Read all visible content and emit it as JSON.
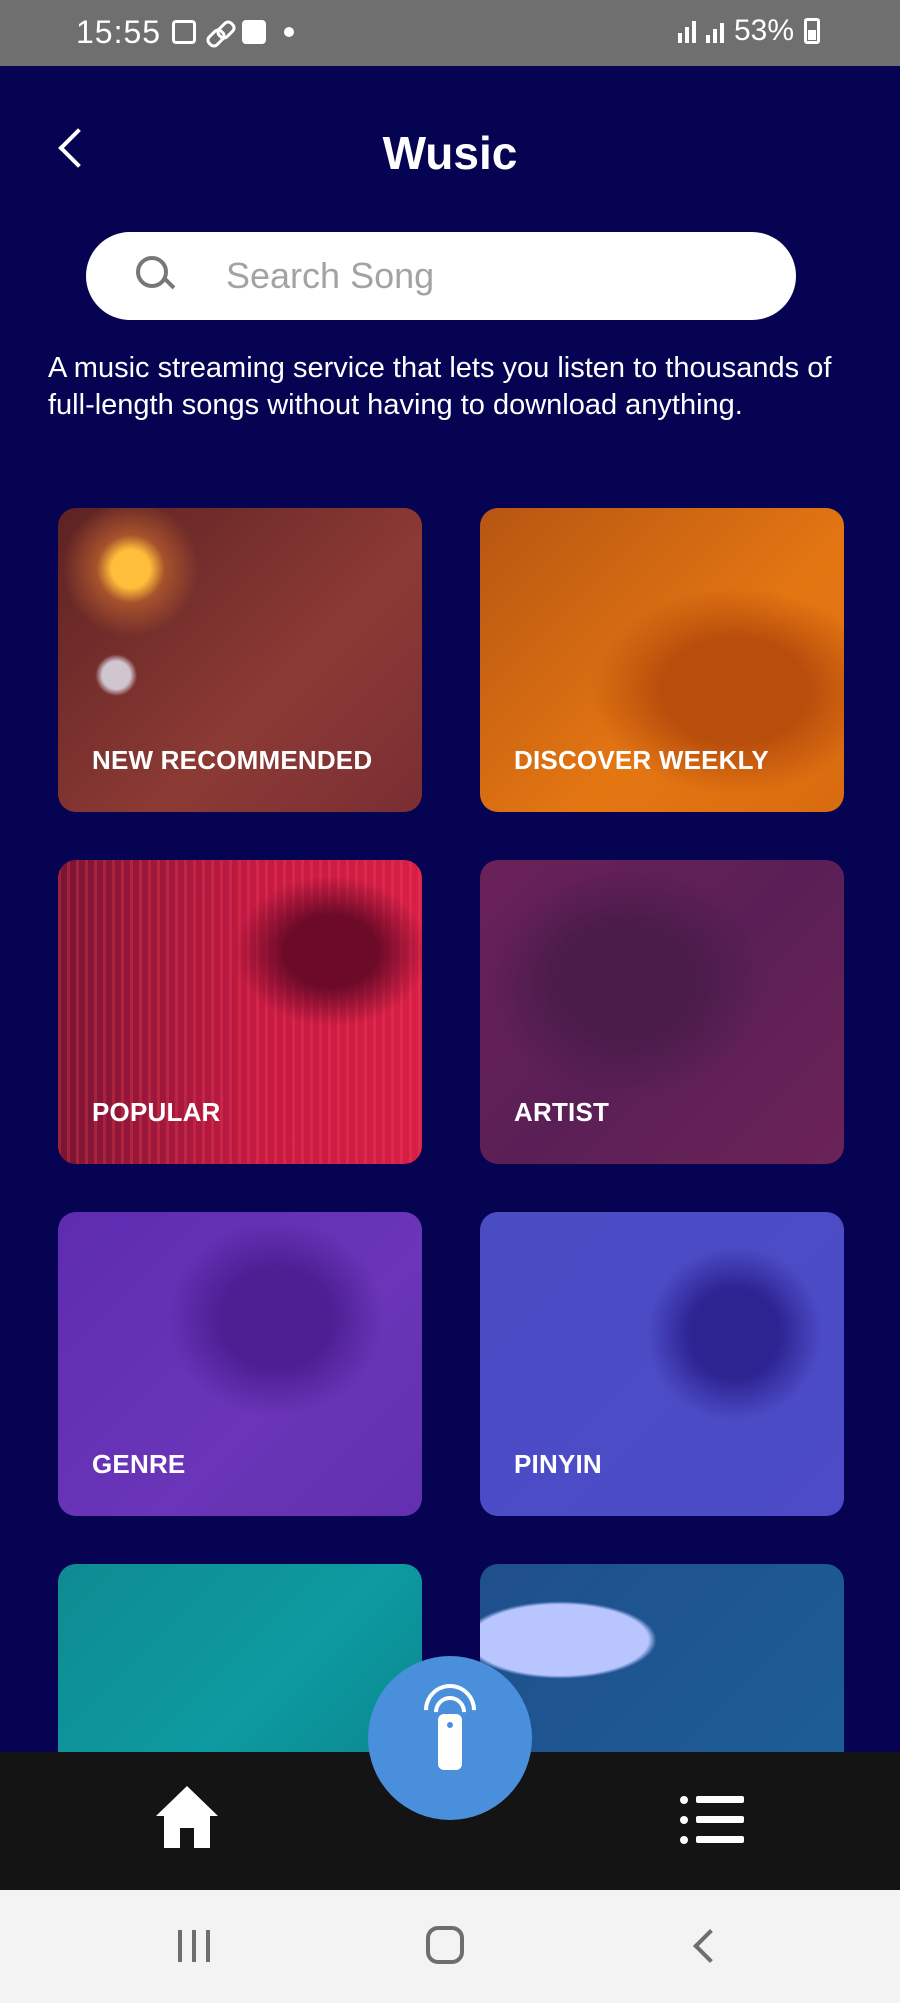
{
  "status_bar": {
    "time": "15:55",
    "battery": "53%"
  },
  "header": {
    "title": "Wusic"
  },
  "search": {
    "placeholder": "Search Song",
    "value": ""
  },
  "description": "A music streaming service that lets you listen to thousands of full-length songs without having to download anything.",
  "categories": [
    {
      "label": "NEW RECOMMENDED",
      "color": "#8c3a34"
    },
    {
      "label": "DISCOVER WEEKLY",
      "color": "#e47612"
    },
    {
      "label": "POPULAR",
      "color": "#c51a44"
    },
    {
      "label": "ARTIST",
      "color": "#5a1f56"
    },
    {
      "label": "GENRE",
      "color": "#6a35b8"
    },
    {
      "label": "PINYIN",
      "color": "#4d4bc7"
    },
    {
      "label": "",
      "color": "#0d9aa0"
    },
    {
      "label": "",
      "color": "#1d5d96"
    }
  ],
  "bottom_nav": {
    "items": [
      {
        "icon": "home-icon"
      },
      {
        "icon": "remote-icon"
      },
      {
        "icon": "list-icon"
      }
    ],
    "accent": "#4a8fdc"
  },
  "colors": {
    "background": "#060352",
    "status_bar": "#6f6f6f",
    "nav_bar": "#141414"
  }
}
